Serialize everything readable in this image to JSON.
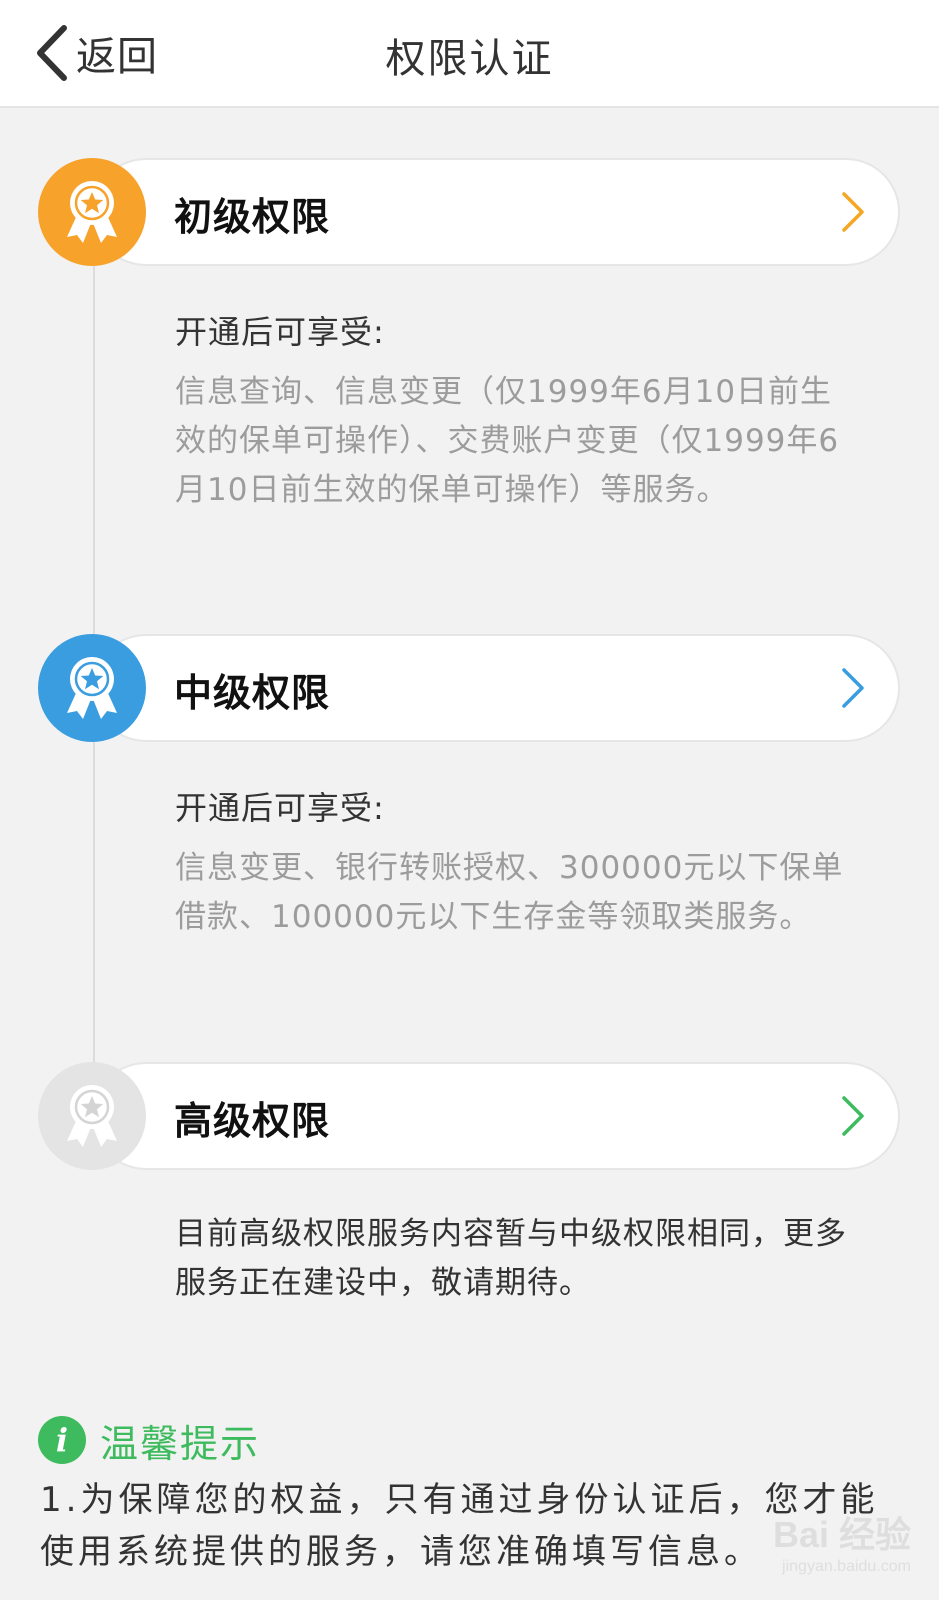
{
  "header": {
    "back_label": "返回",
    "title": "权限认证"
  },
  "levels": [
    {
      "title": "初级权限",
      "badge_color": "#f7a22b",
      "chevron_color": "#f5a623",
      "desc_heading": "开通后可享受:",
      "desc_body": "信息查询、信息变更（仅1999年6月10日前生效的保单可操作）、交费账户变更（仅1999年6月10日前生效的保单可操作）等服务。"
    },
    {
      "title": "中级权限",
      "badge_color": "#3a9de0",
      "chevron_color": "#3a9de0",
      "desc_heading": "开通后可享受:",
      "desc_body": "信息变更、银行转账授权、300000元以下保单借款、100000元以下生存金等领取类服务。"
    },
    {
      "title": "高级权限",
      "badge_color": "#e4e4e4",
      "chevron_color": "#3dbb5e",
      "desc_plain": "目前高级权限服务内容暂与中级权限相同，更多服务正在建设中，敬请期待。"
    }
  ],
  "tips": {
    "icon": "i",
    "title": "温馨提示",
    "text": "1.为保障您的权益，只有通过身份认证后，您才能使用系统提供的服务，请您准确填写信息。"
  },
  "watermark": {
    "logo": "Bai 经验",
    "url": "jingyan.baidu.com"
  }
}
